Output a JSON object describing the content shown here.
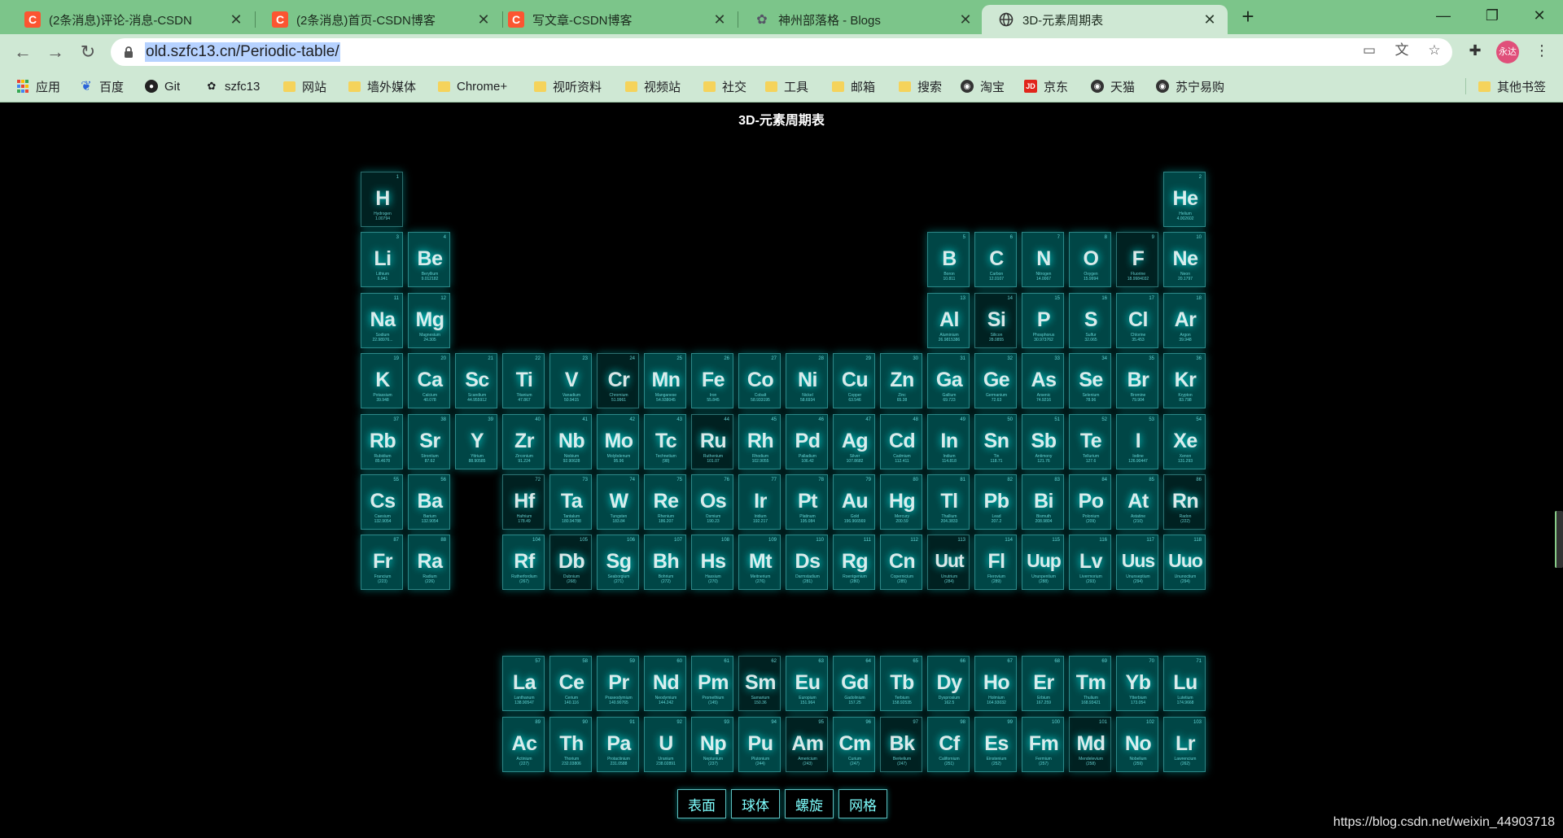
{
  "browser": {
    "tabs": [
      {
        "title": "(2条消息)评论-消息-CSDN",
        "icon": "csdn-icon",
        "active": false
      },
      {
        "title": "(2条消息)首页-CSDN博客",
        "icon": "csdn-icon",
        "active": false
      },
      {
        "title": "写文章-CSDN博客",
        "icon": "csdn-icon",
        "active": false
      },
      {
        "title": "神州部落格 - Blogs",
        "icon": "blog-icon",
        "active": false
      },
      {
        "title": "3D-元素周期表",
        "icon": "globe-icon",
        "active": true
      }
    ],
    "url": "old.szfc13.cn/Periodic-table/",
    "avatar_text": "永达",
    "bookmarks": [
      {
        "label": "应用",
        "icon": "apps-icon"
      },
      {
        "label": "百度",
        "icon": "baidu-icon"
      },
      {
        "label": "Git",
        "icon": "github-icon"
      },
      {
        "label": "szfc13",
        "icon": "site-icon"
      },
      {
        "label": "网站",
        "icon": "folder-icon"
      },
      {
        "label": "墙外媒体",
        "icon": "folder-icon"
      },
      {
        "label": "Chrome+",
        "icon": "folder-icon"
      },
      {
        "label": "视听资料",
        "icon": "folder-icon"
      },
      {
        "label": "视频站",
        "icon": "folder-icon"
      },
      {
        "label": "社交",
        "icon": "folder-icon"
      },
      {
        "label": "工具",
        "icon": "folder-icon"
      },
      {
        "label": "邮箱",
        "icon": "folder-icon"
      },
      {
        "label": "搜索",
        "icon": "folder-icon"
      },
      {
        "label": "淘宝",
        "icon": "globe-icon"
      },
      {
        "label": "京东",
        "icon": "jd-icon"
      },
      {
        "label": "天猫",
        "icon": "globe-icon"
      },
      {
        "label": "苏宁易购",
        "icon": "globe-icon"
      }
    ],
    "other_bookmarks": "其他书签"
  },
  "page": {
    "title": "3D-元素周期表",
    "menu": [
      "表面",
      "球体",
      "螺旋",
      "网格"
    ],
    "footer": "https://blog.csdn.net/weixin_44903718"
  },
  "elements": [
    {
      "num": 1,
      "sym": "H",
      "name": "Hydrogen",
      "mass": "1.00794",
      "col": 1,
      "row": 1
    },
    {
      "num": 2,
      "sym": "He",
      "name": "Helium",
      "mass": "4.002602",
      "col": 18,
      "row": 1
    },
    {
      "num": 3,
      "sym": "Li",
      "name": "Lithium",
      "mass": "6.941",
      "col": 1,
      "row": 2
    },
    {
      "num": 4,
      "sym": "Be",
      "name": "Beryllium",
      "mass": "9.012182",
      "col": 2,
      "row": 2
    },
    {
      "num": 5,
      "sym": "B",
      "name": "Boron",
      "mass": "10.811",
      "col": 13,
      "row": 2
    },
    {
      "num": 6,
      "sym": "C",
      "name": "Carbon",
      "mass": "12.0107",
      "col": 14,
      "row": 2
    },
    {
      "num": 7,
      "sym": "N",
      "name": "Nitrogen",
      "mass": "14.0067",
      "col": 15,
      "row": 2
    },
    {
      "num": 8,
      "sym": "O",
      "name": "Oxygen",
      "mass": "15.9994",
      "col": 16,
      "row": 2
    },
    {
      "num": 9,
      "sym": "F",
      "name": "Fluorine",
      "mass": "18.9984032",
      "col": 17,
      "row": 2
    },
    {
      "num": 10,
      "sym": "Ne",
      "name": "Neon",
      "mass": "20.1797",
      "col": 18,
      "row": 2
    },
    {
      "num": 11,
      "sym": "Na",
      "name": "Sodium",
      "mass": "22.98976...",
      "col": 1,
      "row": 3
    },
    {
      "num": 12,
      "sym": "Mg",
      "name": "Magnesium",
      "mass": "24.305",
      "col": 2,
      "row": 3
    },
    {
      "num": 13,
      "sym": "Al",
      "name": "Aluminium",
      "mass": "26.9815386",
      "col": 13,
      "row": 3
    },
    {
      "num": 14,
      "sym": "Si",
      "name": "Silicon",
      "mass": "28.0855",
      "col": 14,
      "row": 3
    },
    {
      "num": 15,
      "sym": "P",
      "name": "Phosphorus",
      "mass": "30.973762",
      "col": 15,
      "row": 3
    },
    {
      "num": 16,
      "sym": "S",
      "name": "Sulfur",
      "mass": "32.065",
      "col": 16,
      "row": 3
    },
    {
      "num": 17,
      "sym": "Cl",
      "name": "Chlorine",
      "mass": "35.453",
      "col": 17,
      "row": 3
    },
    {
      "num": 18,
      "sym": "Ar",
      "name": "Argon",
      "mass": "39.948",
      "col": 18,
      "row": 3
    },
    {
      "num": 19,
      "sym": "K",
      "name": "Potassium",
      "mass": "39.948",
      "col": 1,
      "row": 4
    },
    {
      "num": 20,
      "sym": "Ca",
      "name": "Calcium",
      "mass": "40.078",
      "col": 2,
      "row": 4
    },
    {
      "num": 21,
      "sym": "Sc",
      "name": "Scandium",
      "mass": "44.955912",
      "col": 3,
      "row": 4
    },
    {
      "num": 22,
      "sym": "Ti",
      "name": "Titanium",
      "mass": "47.867",
      "col": 4,
      "row": 4
    },
    {
      "num": 23,
      "sym": "V",
      "name": "Vanadium",
      "mass": "50.9415",
      "col": 5,
      "row": 4
    },
    {
      "num": 24,
      "sym": "Cr",
      "name": "Chromium",
      "mass": "51.9961",
      "col": 6,
      "row": 4
    },
    {
      "num": 25,
      "sym": "Mn",
      "name": "Manganese",
      "mass": "54.938045",
      "col": 7,
      "row": 4
    },
    {
      "num": 26,
      "sym": "Fe",
      "name": "Iron",
      "mass": "55.845",
      "col": 8,
      "row": 4
    },
    {
      "num": 27,
      "sym": "Co",
      "name": "Cobalt",
      "mass": "58.933195",
      "col": 9,
      "row": 4
    },
    {
      "num": 28,
      "sym": "Ni",
      "name": "Nickel",
      "mass": "58.6934",
      "col": 10,
      "row": 4
    },
    {
      "num": 29,
      "sym": "Cu",
      "name": "Copper",
      "mass": "63.546",
      "col": 11,
      "row": 4
    },
    {
      "num": 30,
      "sym": "Zn",
      "name": "Zinc",
      "mass": "65.38",
      "col": 12,
      "row": 4
    },
    {
      "num": 31,
      "sym": "Ga",
      "name": "Gallium",
      "mass": "69.723",
      "col": 13,
      "row": 4
    },
    {
      "num": 32,
      "sym": "Ge",
      "name": "Germanium",
      "mass": "72.63",
      "col": 14,
      "row": 4
    },
    {
      "num": 33,
      "sym": "As",
      "name": "Arsenic",
      "mass": "74.9216",
      "col": 15,
      "row": 4
    },
    {
      "num": 34,
      "sym": "Se",
      "name": "Selenium",
      "mass": "78.96",
      "col": 16,
      "row": 4
    },
    {
      "num": 35,
      "sym": "Br",
      "name": "Bromine",
      "mass": "79.904",
      "col": 17,
      "row": 4
    },
    {
      "num": 36,
      "sym": "Kr",
      "name": "Krypton",
      "mass": "83.798",
      "col": 18,
      "row": 4
    },
    {
      "num": 37,
      "sym": "Rb",
      "name": "Rubidium",
      "mass": "85.4678",
      "col": 1,
      "row": 5
    },
    {
      "num": 38,
      "sym": "Sr",
      "name": "Strontium",
      "mass": "87.62",
      "col": 2,
      "row": 5
    },
    {
      "num": 39,
      "sym": "Y",
      "name": "Yttrium",
      "mass": "88.90585",
      "col": 3,
      "row": 5
    },
    {
      "num": 40,
      "sym": "Zr",
      "name": "Zirconium",
      "mass": "91.224",
      "col": 4,
      "row": 5
    },
    {
      "num": 41,
      "sym": "Nb",
      "name": "Niobium",
      "mass": "92.90628",
      "col": 5,
      "row": 5
    },
    {
      "num": 42,
      "sym": "Mo",
      "name": "Molybdenum",
      "mass": "95.96",
      "col": 6,
      "row": 5
    },
    {
      "num": 43,
      "sym": "Tc",
      "name": "Technetium",
      "mass": "(98)",
      "col": 7,
      "row": 5
    },
    {
      "num": 44,
      "sym": "Ru",
      "name": "Ruthenium",
      "mass": "101.07",
      "col": 8,
      "row": 5
    },
    {
      "num": 45,
      "sym": "Rh",
      "name": "Rhodium",
      "mass": "102.9055",
      "col": 9,
      "row": 5
    },
    {
      "num": 46,
      "sym": "Pd",
      "name": "Palladium",
      "mass": "106.42",
      "col": 10,
      "row": 5
    },
    {
      "num": 47,
      "sym": "Ag",
      "name": "Silver",
      "mass": "107.8682",
      "col": 11,
      "row": 5
    },
    {
      "num": 48,
      "sym": "Cd",
      "name": "Cadmium",
      "mass": "112.411",
      "col": 12,
      "row": 5
    },
    {
      "num": 49,
      "sym": "In",
      "name": "Indium",
      "mass": "114.818",
      "col": 13,
      "row": 5
    },
    {
      "num": 50,
      "sym": "Sn",
      "name": "Tin",
      "mass": "118.71",
      "col": 14,
      "row": 5
    },
    {
      "num": 51,
      "sym": "Sb",
      "name": "Antimony",
      "mass": "121.76",
      "col": 15,
      "row": 5
    },
    {
      "num": 52,
      "sym": "Te",
      "name": "Tellurium",
      "mass": "127.6",
      "col": 16,
      "row": 5
    },
    {
      "num": 53,
      "sym": "I",
      "name": "Iodine",
      "mass": "126.90447",
      "col": 17,
      "row": 5
    },
    {
      "num": 54,
      "sym": "Xe",
      "name": "Xenon",
      "mass": "131.293",
      "col": 18,
      "row": 5
    },
    {
      "num": 55,
      "sym": "Cs",
      "name": "Caesium",
      "mass": "132.9054",
      "col": 1,
      "row": 6
    },
    {
      "num": 56,
      "sym": "Ba",
      "name": "Barium",
      "mass": "132.9054",
      "col": 2,
      "row": 6
    },
    {
      "num": 72,
      "sym": "Hf",
      "name": "Hafnium",
      "mass": "178.49",
      "col": 4,
      "row": 6
    },
    {
      "num": 73,
      "sym": "Ta",
      "name": "Tantalum",
      "mass": "180.94788",
      "col": 5,
      "row": 6
    },
    {
      "num": 74,
      "sym": "W",
      "name": "Tungsten",
      "mass": "183.84",
      "col": 6,
      "row": 6
    },
    {
      "num": 75,
      "sym": "Re",
      "name": "Rhenium",
      "mass": "186.207",
      "col": 7,
      "row": 6
    },
    {
      "num": 76,
      "sym": "Os",
      "name": "Osmium",
      "mass": "190.23",
      "col": 8,
      "row": 6
    },
    {
      "num": 77,
      "sym": "Ir",
      "name": "Iridium",
      "mass": "192.217",
      "col": 9,
      "row": 6
    },
    {
      "num": 78,
      "sym": "Pt",
      "name": "Platinum",
      "mass": "195.084",
      "col": 10,
      "row": 6
    },
    {
      "num": 79,
      "sym": "Au",
      "name": "Gold",
      "mass": "196.966569",
      "col": 11,
      "row": 6
    },
    {
      "num": 80,
      "sym": "Hg",
      "name": "Mercury",
      "mass": "200.59",
      "col": 12,
      "row": 6
    },
    {
      "num": 81,
      "sym": "Tl",
      "name": "Thallium",
      "mass": "204.3833",
      "col": 13,
      "row": 6
    },
    {
      "num": 82,
      "sym": "Pb",
      "name": "Lead",
      "mass": "207.2",
      "col": 14,
      "row": 6
    },
    {
      "num": 83,
      "sym": "Bi",
      "name": "Bismuth",
      "mass": "208.9804",
      "col": 15,
      "row": 6
    },
    {
      "num": 84,
      "sym": "Po",
      "name": "Polonium",
      "mass": "(209)",
      "col": 16,
      "row": 6
    },
    {
      "num": 85,
      "sym": "At",
      "name": "Astatine",
      "mass": "(210)",
      "col": 17,
      "row": 6
    },
    {
      "num": 86,
      "sym": "Rn",
      "name": "Radon",
      "mass": "(222)",
      "col": 18,
      "row": 6
    },
    {
      "num": 87,
      "sym": "Fr",
      "name": "Francium",
      "mass": "(223)",
      "col": 1,
      "row": 7
    },
    {
      "num": 88,
      "sym": "Ra",
      "name": "Radium",
      "mass": "(226)",
      "col": 2,
      "row": 7
    },
    {
      "num": 104,
      "sym": "Rf",
      "name": "Rutherfordium",
      "mass": "(267)",
      "col": 4,
      "row": 7
    },
    {
      "num": 105,
      "sym": "Db",
      "name": "Dubnium",
      "mass": "(268)",
      "col": 5,
      "row": 7
    },
    {
      "num": 106,
      "sym": "Sg",
      "name": "Seaborgium",
      "mass": "(271)",
      "col": 6,
      "row": 7
    },
    {
      "num": 107,
      "sym": "Bh",
      "name": "Bohrium",
      "mass": "(272)",
      "col": 7,
      "row": 7
    },
    {
      "num": 108,
      "sym": "Hs",
      "name": "Hassium",
      "mass": "(270)",
      "col": 8,
      "row": 7
    },
    {
      "num": 109,
      "sym": "Mt",
      "name": "Meitnerium",
      "mass": "(276)",
      "col": 9,
      "row": 7
    },
    {
      "num": 110,
      "sym": "Ds",
      "name": "Darmstadium",
      "mass": "(281)",
      "col": 10,
      "row": 7
    },
    {
      "num": 111,
      "sym": "Rg",
      "name": "Roentgenium",
      "mass": "(280)",
      "col": 11,
      "row": 7
    },
    {
      "num": 112,
      "sym": "Cn",
      "name": "Copernicium",
      "mass": "(285)",
      "col": 12,
      "row": 7
    },
    {
      "num": 113,
      "sym": "Uut",
      "name": "Unutrium",
      "mass": "(284)",
      "col": 13,
      "row": 7
    },
    {
      "num": 114,
      "sym": "Fl",
      "name": "Flerovium",
      "mass": "(289)",
      "col": 14,
      "row": 7
    },
    {
      "num": 115,
      "sym": "Uup",
      "name": "Ununpentium",
      "mass": "(288)",
      "col": 15,
      "row": 7
    },
    {
      "num": 116,
      "sym": "Lv",
      "name": "Livermorium",
      "mass": "(293)",
      "col": 16,
      "row": 7
    },
    {
      "num": 117,
      "sym": "Uus",
      "name": "Ununseptium",
      "mass": "(294)",
      "col": 17,
      "row": 7
    },
    {
      "num": 118,
      "sym": "Uuo",
      "name": "Ununoctium",
      "mass": "(294)",
      "col": 18,
      "row": 7
    },
    {
      "num": 57,
      "sym": "La",
      "name": "Lanthanum",
      "mass": "138.90547",
      "col": 4,
      "row": 9
    },
    {
      "num": 58,
      "sym": "Ce",
      "name": "Cerium",
      "mass": "140.116",
      "col": 5,
      "row": 9
    },
    {
      "num": 59,
      "sym": "Pr",
      "name": "Praseodymium",
      "mass": "140.90765",
      "col": 6,
      "row": 9
    },
    {
      "num": 60,
      "sym": "Nd",
      "name": "Neodymium",
      "mass": "144.242",
      "col": 7,
      "row": 9
    },
    {
      "num": 61,
      "sym": "Pm",
      "name": "Promethium",
      "mass": "(145)",
      "col": 8,
      "row": 9
    },
    {
      "num": 62,
      "sym": "Sm",
      "name": "Samarium",
      "mass": "150.36",
      "col": 9,
      "row": 9
    },
    {
      "num": 63,
      "sym": "Eu",
      "name": "Europium",
      "mass": "151.964",
      "col": 10,
      "row": 9
    },
    {
      "num": 64,
      "sym": "Gd",
      "name": "Gadolinium",
      "mass": "157.25",
      "col": 11,
      "row": 9
    },
    {
      "num": 65,
      "sym": "Tb",
      "name": "Terbium",
      "mass": "158.92535",
      "col": 12,
      "row": 9
    },
    {
      "num": 66,
      "sym": "Dy",
      "name": "Dysprosium",
      "mass": "162.5",
      "col": 13,
      "row": 9
    },
    {
      "num": 67,
      "sym": "Ho",
      "name": "Holmium",
      "mass": "164.93032",
      "col": 14,
      "row": 9
    },
    {
      "num": 68,
      "sym": "Er",
      "name": "Erbium",
      "mass": "167.259",
      "col": 15,
      "row": 9
    },
    {
      "num": 69,
      "sym": "Tm",
      "name": "Thulium",
      "mass": "168.93421",
      "col": 16,
      "row": 9
    },
    {
      "num": 70,
      "sym": "Yb",
      "name": "Ytterbium",
      "mass": "173.054",
      "col": 17,
      "row": 9
    },
    {
      "num": 71,
      "sym": "Lu",
      "name": "Lutetium",
      "mass": "174.9668",
      "col": 18,
      "row": 9
    },
    {
      "num": 89,
      "sym": "Ac",
      "name": "Actinium",
      "mass": "(227)",
      "col": 4,
      "row": 10
    },
    {
      "num": 90,
      "sym": "Th",
      "name": "Thorium",
      "mass": "232.03806",
      "col": 5,
      "row": 10
    },
    {
      "num": 91,
      "sym": "Pa",
      "name": "Protactinium",
      "mass": "231.0588",
      "col": 6,
      "row": 10
    },
    {
      "num": 92,
      "sym": "U",
      "name": "Uranium",
      "mass": "238.02891",
      "col": 7,
      "row": 10
    },
    {
      "num": 93,
      "sym": "Np",
      "name": "Neptunium",
      "mass": "(237)",
      "col": 8,
      "row": 10
    },
    {
      "num": 94,
      "sym": "Pu",
      "name": "Plutonium",
      "mass": "(244)",
      "col": 9,
      "row": 10
    },
    {
      "num": 95,
      "sym": "Am",
      "name": "Americium",
      "mass": "(243)",
      "col": 10,
      "row": 10
    },
    {
      "num": 96,
      "sym": "Cm",
      "name": "Curium",
      "mass": "(247)",
      "col": 11,
      "row": 10
    },
    {
      "num": 97,
      "sym": "Bk",
      "name": "Berkelium",
      "mass": "(247)",
      "col": 12,
      "row": 10
    },
    {
      "num": 98,
      "sym": "Cf",
      "name": "Californium",
      "mass": "(251)",
      "col": 13,
      "row": 10
    },
    {
      "num": 99,
      "sym": "Es",
      "name": "Einstenium",
      "mass": "(252)",
      "col": 14,
      "row": 10
    },
    {
      "num": 100,
      "sym": "Fm",
      "name": "Fermium",
      "mass": "(257)",
      "col": 15,
      "row": 10
    },
    {
      "num": 101,
      "sym": "Md",
      "name": "Mendelevium",
      "mass": "(258)",
      "col": 16,
      "row": 10
    },
    {
      "num": 102,
      "sym": "No",
      "name": "Nobelium",
      "mass": "(259)",
      "col": 17,
      "row": 10
    },
    {
      "num": 103,
      "sym": "Lr",
      "name": "Lawrencium",
      "mass": "(262)",
      "col": 18,
      "row": 10
    }
  ]
}
